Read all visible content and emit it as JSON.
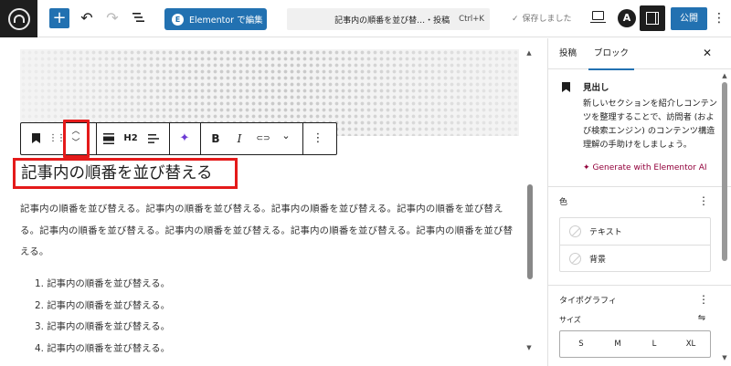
{
  "topbar": {
    "add_icon": "plus-icon",
    "elementor_button": "Elementor で編集",
    "elementor_badge": "E",
    "command": {
      "title": "記事内の順番を並び替…・投稿",
      "shortcut": "Ctrl+K"
    },
    "saved_label": "保存しました",
    "saved_check": "✓",
    "avatar_letter": "A",
    "publish_label": "公開",
    "more_glyph": "⋮",
    "accent_color": "#2271b1"
  },
  "block_toolbar": {
    "heading_level": "H2",
    "bold": "B",
    "italic": "I",
    "more": "⋮",
    "chevron": "⌄",
    "link": "⊂⊃",
    "ai_spark": "✦"
  },
  "content": {
    "heading": "記事内の順番を並び替える",
    "paragraph": "記事内の順番を並び替える。記事内の順番を並び替える。記事内の順番を並び替える。記事内の順番を並び替える。記事内の順番を並び替える。記事内の順番を並び替える。記事内の順番を並び替える。記事内の順番を並び替える。",
    "list": [
      "1. 記事内の順番を並び替える。",
      "2. 記事内の順番を並び替える。",
      "3. 記事内の順番を並び替える。",
      "4. 記事内の順番を並び替える。"
    ],
    "highlight_color": "#e41a1a"
  },
  "sidebar": {
    "tabs": [
      {
        "label": "投稿",
        "active": false
      },
      {
        "label": "ブロック",
        "active": true
      }
    ],
    "close_glyph": "✕",
    "block": {
      "title": "見出し",
      "description": "新しいセクションを紹介しコンテンツを整理することで、訪問者 (および検索エンジン) のコンテンツ構造理解の手助けをしましょう。",
      "ai_link": "Generate with Elementor AI",
      "ai_spark": "✦"
    },
    "color_section": {
      "title": "色",
      "items": [
        "テキスト",
        "背景"
      ]
    },
    "typography": {
      "title": "タイポグラフィ",
      "size_label": "サイズ",
      "sizes": [
        "S",
        "M",
        "L",
        "XL"
      ],
      "tune_glyph": "⇋"
    },
    "more_glyph": "⋮"
  }
}
